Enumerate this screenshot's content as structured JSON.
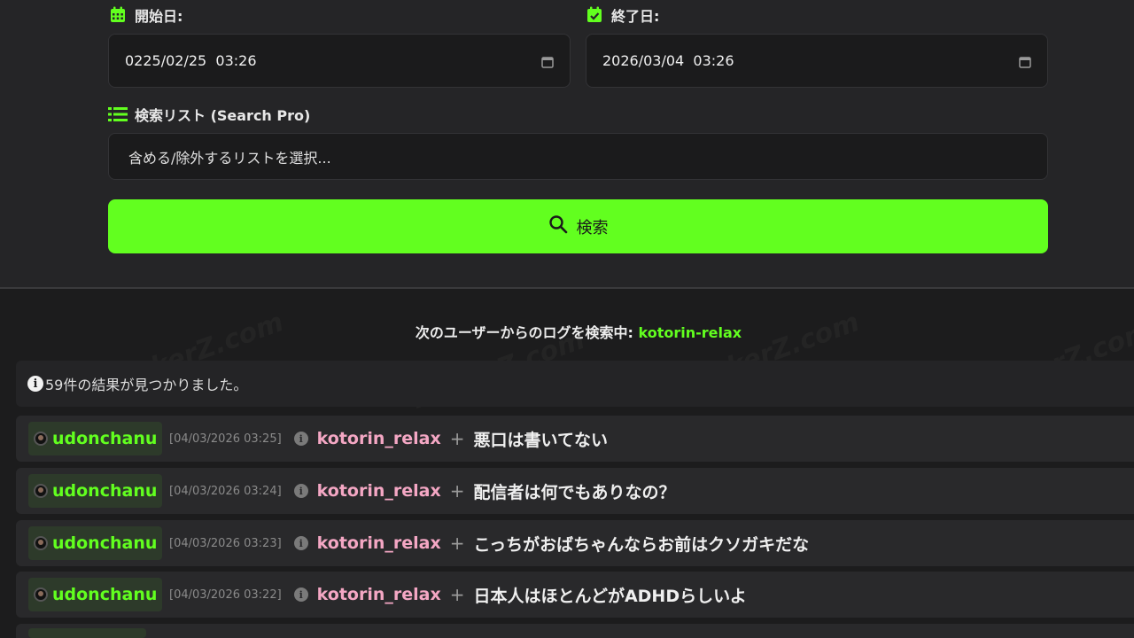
{
  "form": {
    "start_label": "開始日:",
    "start_value": "0225/02/25  03:26",
    "end_label": "終了日:",
    "end_value": "2026/03/04  03:26",
    "list_label": "検索リスト (Search Pro)",
    "list_placeholder": "含める/除外するリストを選択...",
    "search_button": "検索",
    "accent": "#62ff1f"
  },
  "status": {
    "prefix": "次のユーザーからのログを検索中: ",
    "user": "kotorin-relax"
  },
  "results": {
    "count_text": "59件の結果が見つかりました。"
  },
  "watermark": "kickerZ.com",
  "logs": [
    {
      "user": "udonchanu",
      "time": "[04/03/2026 03:25]",
      "target": "kotorin_relax",
      "message": "悪口は書いてない"
    },
    {
      "user": "udonchanu",
      "time": "[04/03/2026 03:24]",
      "target": "kotorin_relax",
      "message": "配信者は何でもありなの？"
    },
    {
      "user": "udonchanu",
      "time": "[04/03/2026 03:23]",
      "target": "kotorin_relax",
      "message": "こっちがおばちゃんならお前はクソガキだな"
    },
    {
      "user": "udonchanu",
      "time": "[04/03/2026 03:22]",
      "target": "kotorin_relax",
      "message": "日本人はほとんどがADHDらしいよ"
    }
  ]
}
